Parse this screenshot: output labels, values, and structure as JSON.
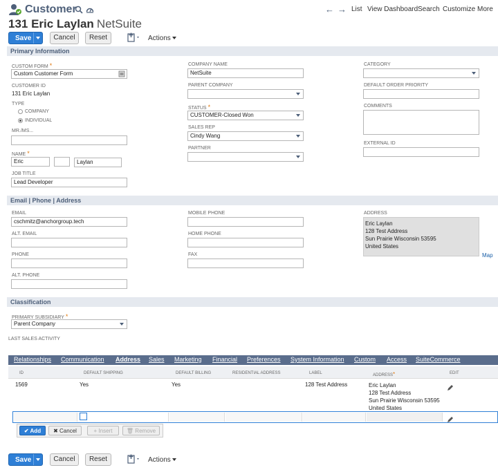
{
  "header": {
    "record_type": "Customer",
    "record_title": "131 Eric Laylan",
    "record_subtitle": "NetSuite",
    "nav": {
      "list": "List",
      "view_dashboard": "View Dashboard",
      "search": "Search",
      "customize": "Customize",
      "more": "More"
    }
  },
  "toolbar": {
    "save": "Save",
    "cancel": "Cancel",
    "reset": "Reset",
    "actions": "Actions"
  },
  "sections": {
    "primary": "Primary Information",
    "email_phone": "Email | Phone | Address",
    "classification": "Classification"
  },
  "primary": {
    "custom_form_label": "CUSTOM FORM",
    "custom_form_value": "Custom Customer Form",
    "customer_id_label": "CUSTOMER ID",
    "customer_id_value": "131 Eric Laylan",
    "type_label": "TYPE",
    "type_company": "COMPANY",
    "type_individual": "INDIVIDUAL",
    "mr_ms_label": "MR./MS...",
    "name_label": "NAME",
    "first_name": "Eric",
    "middle_name": "",
    "last_name": "Laylan",
    "job_title_label": "JOB TITLE",
    "job_title_value": "Lead Developer",
    "company_name_label": "COMPANY NAME",
    "company_name_value": "NetSuite",
    "parent_company_label": "PARENT COMPANY",
    "status_label": "STATUS",
    "status_value": "CUSTOMER-Closed Won",
    "sales_rep_label": "SALES REP",
    "sales_rep_value": "Cindy Wang",
    "partner_label": "PARTNER",
    "category_label": "CATEGORY",
    "default_order_priority_label": "DEFAULT ORDER PRIORITY",
    "comments_label": "COMMENTS",
    "external_id_label": "EXTERNAL ID"
  },
  "contact": {
    "email_label": "EMAIL",
    "email_value": "cschmitz@anchorgroup.tech",
    "alt_email_label": "ALT. EMAIL",
    "phone_label": "PHONE",
    "alt_phone_label": "ALT. PHONE",
    "mobile_phone_label": "MOBILE PHONE",
    "home_phone_label": "HOME PHONE",
    "fax_label": "FAX",
    "address_label": "ADDRESS",
    "address_lines": [
      "Eric Laylan",
      "128 Test Address",
      "Sun Prairie Wisconsin 53595",
      "United States"
    ],
    "map_link": "Map"
  },
  "classification": {
    "primary_subsidiary_label": "PRIMARY SUBSIDIARY",
    "primary_subsidiary_value": "Parent Company",
    "last_sales_activity_label": "LAST SALES ACTIVITY"
  },
  "tabs": [
    "Relationships",
    "Communication",
    "Address",
    "Sales",
    "Marketing",
    "Financial",
    "Preferences",
    "System Information",
    "Custom",
    "Access",
    "SuiteCommerce"
  ],
  "address_table": {
    "columns": [
      "ID",
      "DEFAULT SHIPPING",
      "DEFAULT BILLING",
      "RESIDENTIAL ADDRESS",
      "LABEL",
      "ADDRESS",
      "EDIT"
    ],
    "row": {
      "id": "1569",
      "default_shipping": "Yes",
      "default_billing": "Yes",
      "residential": "",
      "label": "128 Test Address",
      "address_lines": [
        "Eric Laylan",
        "128 Test Address",
        "Sun Prairie Wisconsin 53595",
        "United States"
      ]
    }
  },
  "sublist_buttons": {
    "add": "Add",
    "cancel": "Cancel",
    "insert": "Insert",
    "remove": "Remove"
  },
  "colors": {
    "accent": "#2e7fd6",
    "header_blue": "#4d5f79",
    "tab_bar": "#5a6d8c",
    "section_bg": "#e5e9ef",
    "required": "#e07a10"
  }
}
